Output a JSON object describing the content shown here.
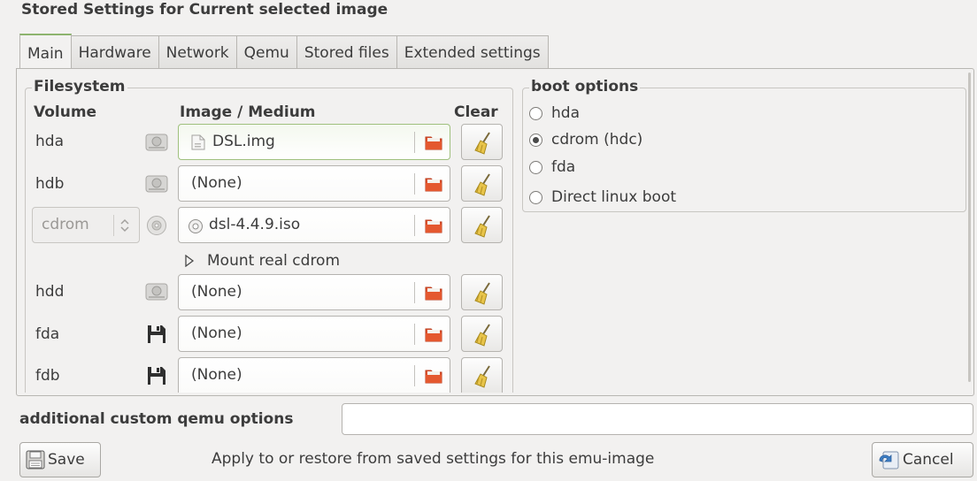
{
  "header": {
    "title": "Stored Settings for Current selected image"
  },
  "tabs": [
    {
      "label": "Main",
      "active": true
    },
    {
      "label": "Hardware"
    },
    {
      "label": "Network"
    },
    {
      "label": "Qemu"
    },
    {
      "label": "Stored files"
    },
    {
      "label": "Extended settings"
    }
  ],
  "filesystem": {
    "legend": "Filesystem",
    "col_volume": "Volume",
    "col_image": "Image / Medium",
    "col_clear": "Clear",
    "drives": [
      {
        "label": "hda",
        "value": "DSL.img",
        "icon": "hard-disk-icon"
      },
      {
        "label": "hdb",
        "value": "(None)",
        "icon": "hard-disk-icon"
      },
      {
        "label": "cdrom",
        "value": "dsl-4.4.9.iso",
        "icon": "cd-icon"
      },
      {
        "label": "hdd",
        "value": "(None)",
        "icon": "hard-disk-icon"
      },
      {
        "label": "fda",
        "value": "(None)",
        "icon": "floppy-icon"
      },
      {
        "label": "fdb",
        "value": "(None)",
        "icon": "floppy-icon"
      }
    ],
    "mount_real_cdrom": "Mount real cdrom"
  },
  "boot": {
    "legend": "boot options",
    "options": [
      {
        "label": "hda",
        "selected": false
      },
      {
        "label": "cdrom (hdc)",
        "selected": true
      },
      {
        "label": "fda",
        "selected": false
      },
      {
        "label": "Direct linux boot",
        "selected": false
      }
    ]
  },
  "custom": {
    "label": "additional custom qemu options",
    "value": ""
  },
  "footer": {
    "save_label": "Save",
    "info": "Apply to or restore from saved settings for this emu-image",
    "cancel_label": "Cancel"
  },
  "colors": {
    "accent": "#8db46e",
    "folder": "#d9472b"
  }
}
